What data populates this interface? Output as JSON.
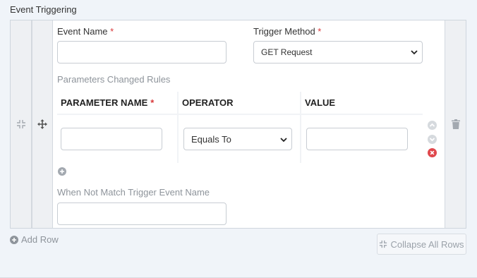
{
  "section": {
    "title": "Event Triggering"
  },
  "fields": {
    "event_name": {
      "label": "Event Name",
      "required_mark": "*",
      "value": ""
    },
    "trigger_method": {
      "label": "Trigger Method",
      "required_mark": "*",
      "selected": "GET Request"
    },
    "params_rules_label": "Parameters Changed Rules",
    "when_not_match": {
      "label": "When Not Match Trigger Event Name",
      "value": ""
    }
  },
  "table": {
    "headers": {
      "param_name": "PARAMETER NAME",
      "param_required": "*",
      "operator": "OPERATOR",
      "value": "VALUE"
    },
    "rows": [
      {
        "param_name": "",
        "operator": "Equals To",
        "value": ""
      }
    ]
  },
  "actions": {
    "add_row": "Add Row",
    "collapse_all": "Collapse All Rows"
  },
  "colors": {
    "accent_red": "#d9383a",
    "muted": "#8e949b",
    "panel_bg": "#f0f4f9"
  },
  "icons": [
    "collapse-arrows-icon",
    "move-icon",
    "trash-icon",
    "chevron-up-circle-icon",
    "chevron-down-circle-icon",
    "remove-circle-icon",
    "plus-circle-icon",
    "chevron-down-icon"
  ]
}
